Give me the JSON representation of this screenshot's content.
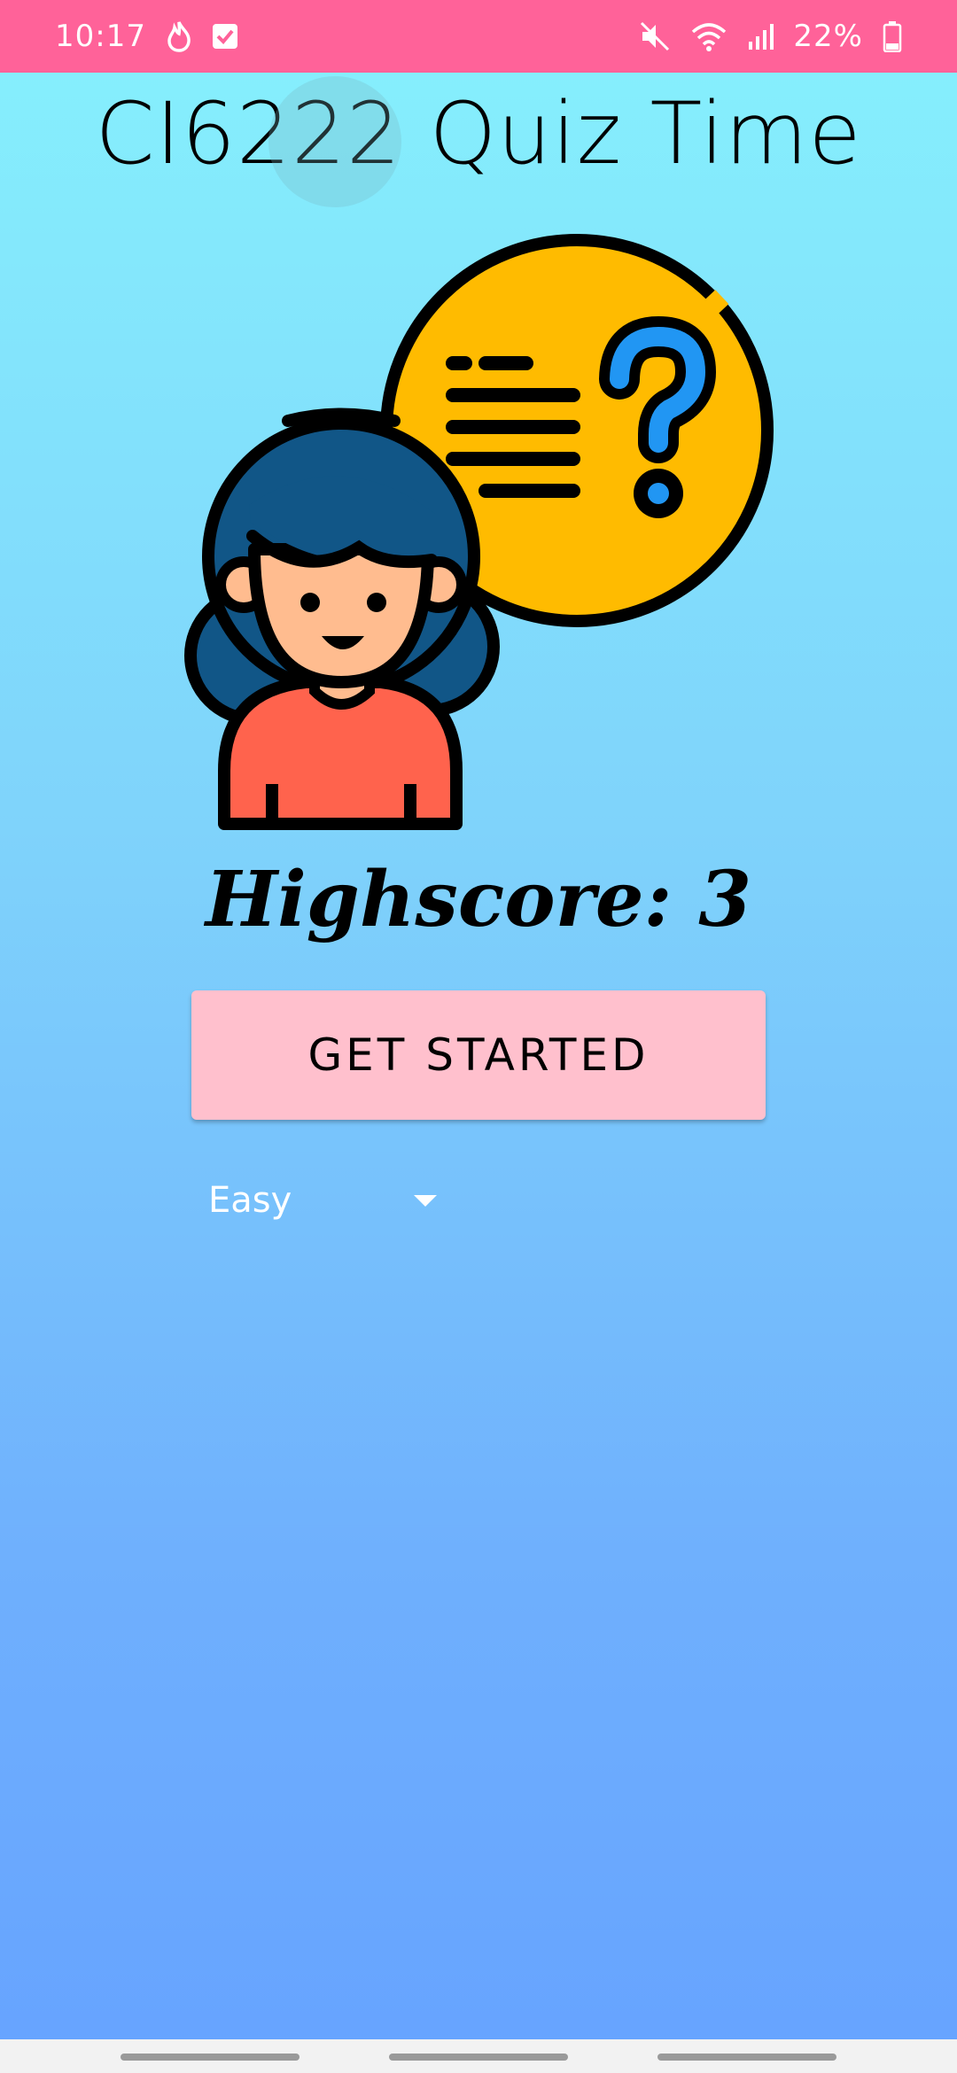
{
  "status_bar": {
    "time": "10:17",
    "battery": "22%",
    "icons": [
      "flame-icon",
      "checkbox-icon",
      "mute-icon",
      "wifi-icon",
      "signal-icon",
      "battery-icon"
    ]
  },
  "app": {
    "title": "CI6222 Quiz Time",
    "highscore_label": "Highscore:",
    "highscore_value": "3",
    "start_button": "GET STARTED",
    "difficulty": {
      "selected": "Easy"
    }
  },
  "colors": {
    "status_bar": "#ff6299",
    "button": "#ffc0cd",
    "bubble": "#ffbb00",
    "hair": "#115687",
    "shirt": "#ff634d",
    "skin": "#ffbc8f",
    "question_mark": "#2196f3"
  }
}
